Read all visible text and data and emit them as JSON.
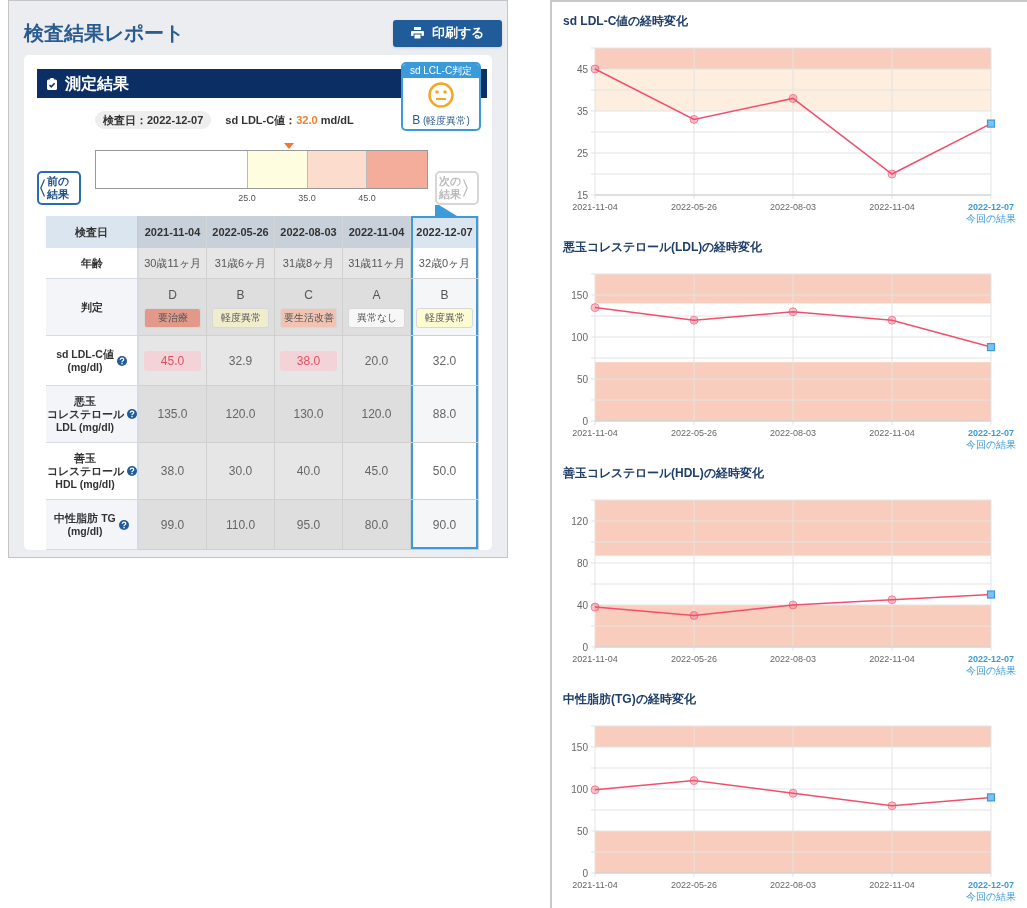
{
  "page": {
    "title": "検査結果レポート",
    "print_button": "印刷する"
  },
  "results": {
    "heading": "測定結果",
    "judgement_badge": {
      "title": "sd LCL-C判定",
      "grade": "B",
      "label": "(軽度異常)"
    },
    "exam_date": "検査日：2022-12-07",
    "value_line": {
      "label": "sd LDL-C値：",
      "value": "32.0",
      "unit": "md/dL"
    },
    "range_bar": {
      "segments": [
        {
          "color": "#fefde0"
        },
        {
          "color": "#fbdccd"
        },
        {
          "color": "#f5ad9b"
        }
      ],
      "boundaries": [
        "25.0",
        "35.0",
        "45.0"
      ],
      "marker": {
        "level": 0.58
      }
    },
    "prev_button": {
      "label": "前の結果",
      "disabled": false
    },
    "next_button": {
      "label": "次の結果",
      "disabled": true
    },
    "table": {
      "corner": "検査日",
      "columns": [
        {
          "label": "2021-11-04",
          "selected": false
        },
        {
          "label": "2022-05-26",
          "selected": false
        },
        {
          "label": "2022-08-03",
          "selected": false
        },
        {
          "label": "2022-11-04",
          "selected": false
        },
        {
          "label": "2022-12-07",
          "selected": true
        }
      ],
      "rows": [
        {
          "kind": "text",
          "label_lines": [
            "年齢"
          ],
          "cells": [
            "30歳11ヶ月",
            "31歳6ヶ月",
            "31歳8ヶ月",
            "31歳11ヶ月",
            "32歳0ヶ月"
          ]
        },
        {
          "kind": "judgement",
          "label_lines": [
            "判定"
          ],
          "cells": [
            {
              "grade": "D",
              "label": "要治療",
              "color": "#e3998a"
            },
            {
              "grade": "B",
              "label": "軽度異常",
              "color": "#efedcc"
            },
            {
              "grade": "C",
              "label": "要生活改善",
              "color": "#f1c3b3"
            },
            {
              "grade": "A",
              "label": "異常なし",
              "color": "#f7f7f7"
            },
            {
              "grade": "B",
              "label": "軽度異常",
              "color": "#fdfbd2"
            }
          ]
        },
        {
          "kind": "value",
          "label_lines": [
            "sd LDL-C値",
            "(mg/dl)"
          ],
          "help": true,
          "cells": [
            {
              "value": "45.0",
              "flagged": true
            },
            {
              "value": "32.9",
              "flagged": false
            },
            {
              "value": "38.0",
              "flagged": true
            },
            {
              "value": "20.0",
              "flagged": false
            },
            {
              "value": "32.0",
              "flagged": false
            }
          ]
        },
        {
          "kind": "value",
          "label_lines": [
            "悪玉",
            "コレステロール",
            "LDL (mg/dl)"
          ],
          "help": true,
          "cells": [
            {
              "value": "135.0",
              "flagged": false
            },
            {
              "value": "120.0",
              "flagged": false
            },
            {
              "value": "130.0",
              "flagged": false
            },
            {
              "value": "120.0",
              "flagged": false
            },
            {
              "value": "88.0",
              "flagged": false
            }
          ]
        },
        {
          "kind": "value",
          "label_lines": [
            "善玉",
            "コレステロール",
            "HDL (mg/dl)"
          ],
          "help": true,
          "cells": [
            {
              "value": "38.0",
              "flagged": false
            },
            {
              "value": "30.0",
              "flagged": false
            },
            {
              "value": "40.0",
              "flagged": false
            },
            {
              "value": "45.0",
              "flagged": false
            },
            {
              "value": "50.0",
              "flagged": false
            }
          ]
        },
        {
          "kind": "value",
          "label_lines": [
            "中性脂肪 TG",
            "(mg/dl)"
          ],
          "help": true,
          "cells": [
            {
              "value": "99.0",
              "flagged": false
            },
            {
              "value": "110.0",
              "flagged": false
            },
            {
              "value": "95.0",
              "flagged": false
            },
            {
              "value": "80.0",
              "flagged": false
            },
            {
              "value": "90.0",
              "flagged": false
            }
          ]
        }
      ]
    }
  },
  "charts": [
    {
      "title": "sd LDL-C値の経時変化",
      "current_label": "今回の結果",
      "chart_data": {
        "type": "line",
        "categories": [
          "2021-11-04",
          "2022-05-26",
          "2022-08-03",
          "2022-11-04",
          "2022-12-07"
        ],
        "series": [
          {
            "color": "#f0506e",
            "marker": "circle",
            "values": [
              45,
              33,
              38,
              20,
              32
            ]
          }
        ],
        "ylim": [
          15,
          50
        ],
        "yticks": [
          15,
          25,
          35,
          45
        ],
        "grid": true,
        "bands": [
          {
            "axis": "y",
            "from": 45,
            "to": 50,
            "color": "#f8cdbd"
          },
          {
            "axis": "y",
            "from": 35,
            "to": 45,
            "color": "#fdeee0"
          }
        ]
      }
    },
    {
      "title": "悪玉コレステロール(LDL)の経時変化",
      "current_label": "今回の結果",
      "chart_data": {
        "type": "line",
        "categories": [
          "2021-11-04",
          "2022-05-26",
          "2022-08-03",
          "2022-11-04",
          "2022-12-07"
        ],
        "series": [
          {
            "color": "#f0506e",
            "marker": "circle",
            "values": [
              135,
              120,
              130,
              120,
              88
            ]
          }
        ],
        "ylim": [
          0,
          175
        ],
        "yticks": [
          0,
          50,
          100,
          150
        ],
        "grid": true,
        "bands": [
          {
            "axis": "y",
            "from": 140,
            "to": 175,
            "color": "#f8cdbd"
          },
          {
            "axis": "y",
            "from": 0,
            "to": 70,
            "color": "#f8cdbd"
          }
        ]
      }
    },
    {
      "title": "善玉コレステロール(HDL)の経時変化",
      "current_label": "今回の結果",
      "chart_data": {
        "type": "line",
        "categories": [
          "2021-11-04",
          "2022-05-26",
          "2022-08-03",
          "2022-11-04",
          "2022-12-07"
        ],
        "series": [
          {
            "color": "#f0506e",
            "marker": "circle",
            "values": [
              38,
              30,
              40,
              45,
              50
            ]
          }
        ],
        "ylim": [
          0,
          140
        ],
        "yticks": [
          0,
          40,
          80,
          120
        ],
        "grid": true,
        "bands": [
          {
            "axis": "y",
            "from": 87,
            "to": 140,
            "color": "#f8cdbd"
          },
          {
            "axis": "y",
            "from": 0,
            "to": 40,
            "color": "#f8cdbd"
          }
        ]
      }
    },
    {
      "title": "中性脂肪(TG)の経時変化",
      "current_label": "今回の結果",
      "chart_data": {
        "type": "line",
        "categories": [
          "2021-11-04",
          "2022-05-26",
          "2022-08-03",
          "2022-11-04",
          "2022-12-07"
        ],
        "series": [
          {
            "color": "#f0506e",
            "marker": "circle",
            "values": [
              99,
              110,
              95,
              80,
              90
            ]
          }
        ],
        "ylim": [
          0,
          175
        ],
        "yticks": [
          0,
          50,
          100,
          150
        ],
        "grid": true,
        "bands": [
          {
            "axis": "y",
            "from": 150,
            "to": 175,
            "color": "#f8cdbd"
          },
          {
            "axis": "y",
            "from": 0,
            "to": 50,
            "color": "#f8cdbd"
          }
        ]
      }
    }
  ]
}
